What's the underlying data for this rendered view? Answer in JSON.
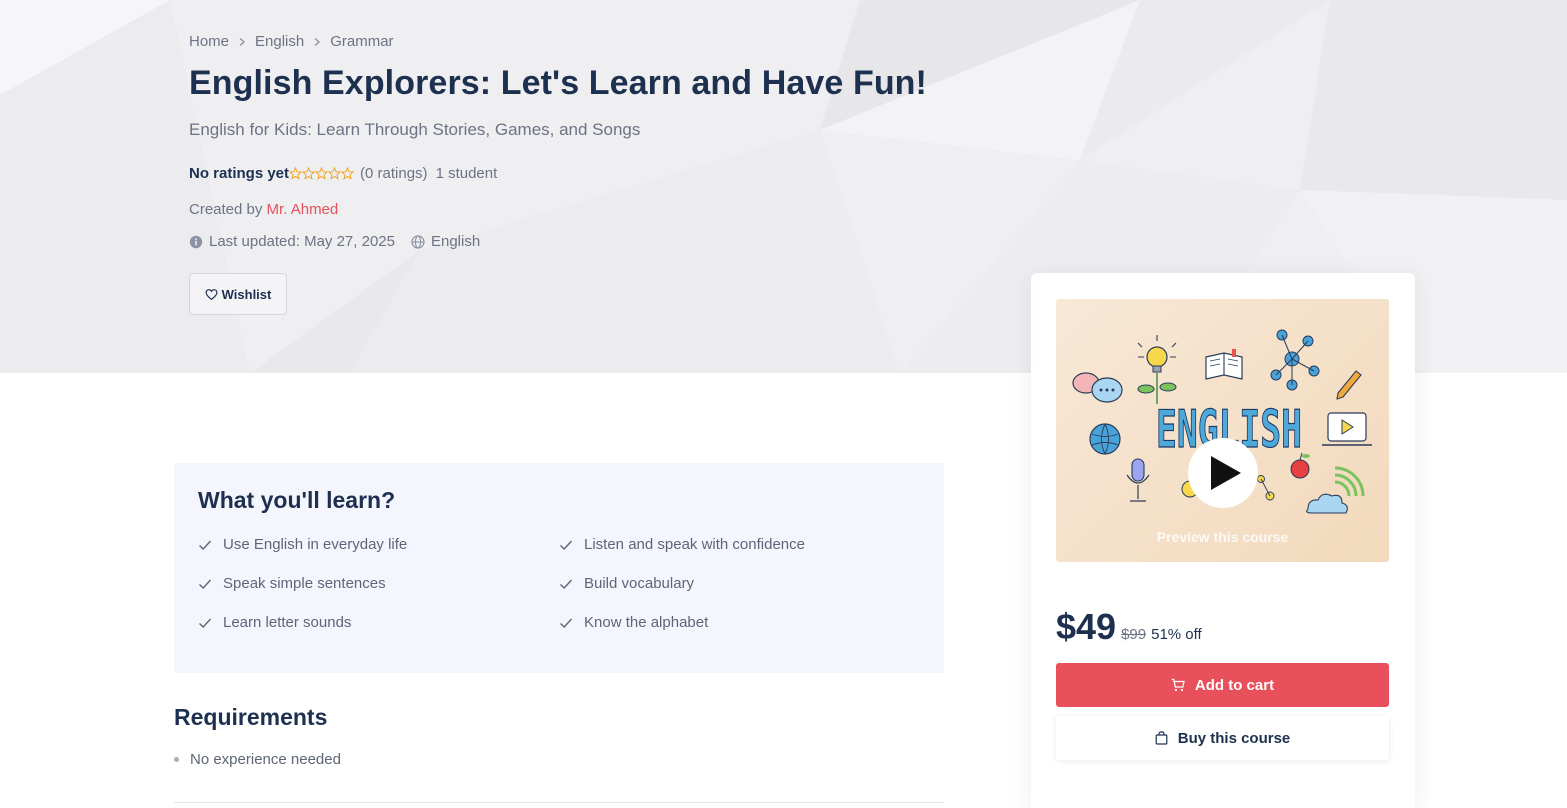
{
  "breadcrumb": [
    "Home",
    "English",
    "Grammar"
  ],
  "course": {
    "title": "English Explorers: Let's Learn and Have Fun!",
    "subtitle": "English for Kids: Learn Through Stories, Games, and Songs",
    "rating_label": "No ratings yet",
    "rating_value": 0,
    "rating_max": 5,
    "ratings_count": "(0 ratings)",
    "students": "1 student",
    "created_by_label": "Created by",
    "author": "Mr. Ahmed",
    "last_updated": "Last updated: May 27, 2025",
    "language": "English",
    "wishlist_label": "Wishlist"
  },
  "learn": {
    "title": "What you'll learn?",
    "items": [
      "Use English in everyday life",
      "Listen and speak with confidence",
      "Speak simple sentences",
      "Build vocabulary",
      "Learn letter sounds",
      "Know the alphabet"
    ]
  },
  "requirements": {
    "title": "Requirements",
    "items": [
      "No experience needed"
    ]
  },
  "sidebar": {
    "preview_label": "Preview this course",
    "thumbnail_word": "ENGLISH",
    "price": "$49",
    "old_price": "$99",
    "discount": "51% off",
    "add_to_cart": "Add to cart",
    "buy_course": "Buy this course"
  },
  "colors": {
    "accent": "#e8505b",
    "heading": "#1e3050",
    "muted": "#6b7385",
    "star": "#f0a020",
    "learn_bg": "#f5f6fd"
  },
  "icons": [
    "chevron-right-icon",
    "star-outline-icon",
    "info-icon",
    "globe-icon",
    "heart-icon",
    "check-icon",
    "play-icon",
    "cart-icon",
    "shopping-bag-icon"
  ]
}
